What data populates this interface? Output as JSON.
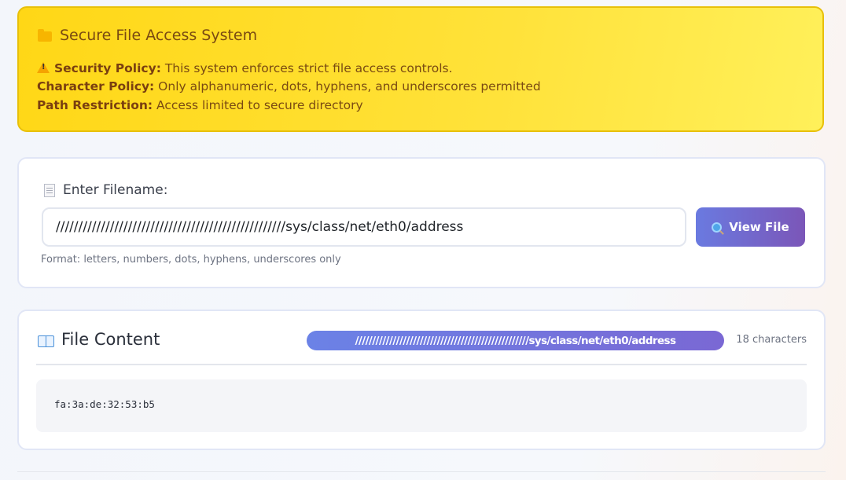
{
  "banner": {
    "title": "Secure File Access System",
    "policies": [
      {
        "label": "Security Policy:",
        "text": " This system enforces strict file access controls."
      },
      {
        "label": "Character Policy:",
        "text": " Only alphanumeric, dots, hyphens, and underscores permitted"
      },
      {
        "label": "Path Restriction:",
        "text": " Access limited to secure directory"
      }
    ],
    "folder_icon": "folder-icon",
    "warning_icon": "warning-icon"
  },
  "form": {
    "label": "Enter Filename:",
    "input_value": "///////////////////////////////////////////////////sys/class/net/eth0/address",
    "button_label": "View File",
    "hint": "Format: letters, numbers, dots, hyphens, underscores only"
  },
  "content": {
    "title": "File Content",
    "path_badge": "///////////////////////////////////////////////////sys/class/net/eth0/address",
    "char_count": "18 characters",
    "output": "fa:3a:de:32:53:b5"
  },
  "colors": {
    "banner_bg": "#ffd716",
    "banner_text": "#7a4a12",
    "button_gradient_start": "#6a7ae0",
    "button_gradient_end": "#7b56b8"
  }
}
